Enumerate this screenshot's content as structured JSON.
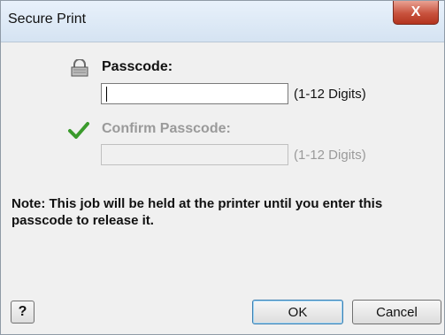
{
  "window": {
    "title": "Secure Print",
    "close_label": "X"
  },
  "passcode": {
    "label": "Passcode:",
    "value": "",
    "hint": "(1-12 Digits)",
    "icon": "lock-icon"
  },
  "confirm": {
    "label": "Confirm Passcode:",
    "value": "",
    "hint": "(1-12 Digits)",
    "icon": "checkmark-icon",
    "enabled": false
  },
  "note": "Note:  This job will be held at the printer until you enter this passcode to release it.",
  "buttons": {
    "help": "?",
    "ok": "OK",
    "cancel": "Cancel"
  },
  "colors": {
    "check": "#3a9a2c",
    "close": "#c8523d",
    "disabled_text": "#9a9a9a"
  }
}
